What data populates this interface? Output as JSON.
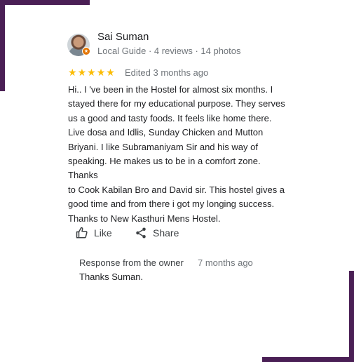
{
  "reviewer": {
    "name": "Sai Suman",
    "meta": "Local Guide · 4 reviews · 14 photos"
  },
  "rating": {
    "stars": 5,
    "max": 5,
    "star_color": "#fbbc04",
    "edited_label": "Edited 3 months ago"
  },
  "review": {
    "lines": [
      "Hi.. I 've been in the Hostel for almost six months. I",
      "stayed there for my educational purpose. They serves",
      "us a good and tasty foods. It feels like home there.",
      "Live dosa and Idlis, Sunday Chicken and Mutton",
      "Briyani. I like Subramaniyam Sir and his way of",
      "speaking. He makes us to be in a comfort zone. Thanks",
      "to Cook Kabilan Bro and David sir. This hostel gives a",
      "good time and from there i got my longing success.",
      "Thanks to New Kasthuri Mens Hostel."
    ]
  },
  "actions": {
    "like_label": "Like",
    "like_icon": "thumb-up-icon",
    "share_label": "Share",
    "share_icon": "share-icon"
  },
  "owner_response": {
    "heading": "Response from the owner",
    "time": "7 months ago",
    "text": "Thanks Suman."
  },
  "colors": {
    "frame_accent": "#4a1f55",
    "guide_badge": "#e37400",
    "secondary_text": "#70757a"
  }
}
